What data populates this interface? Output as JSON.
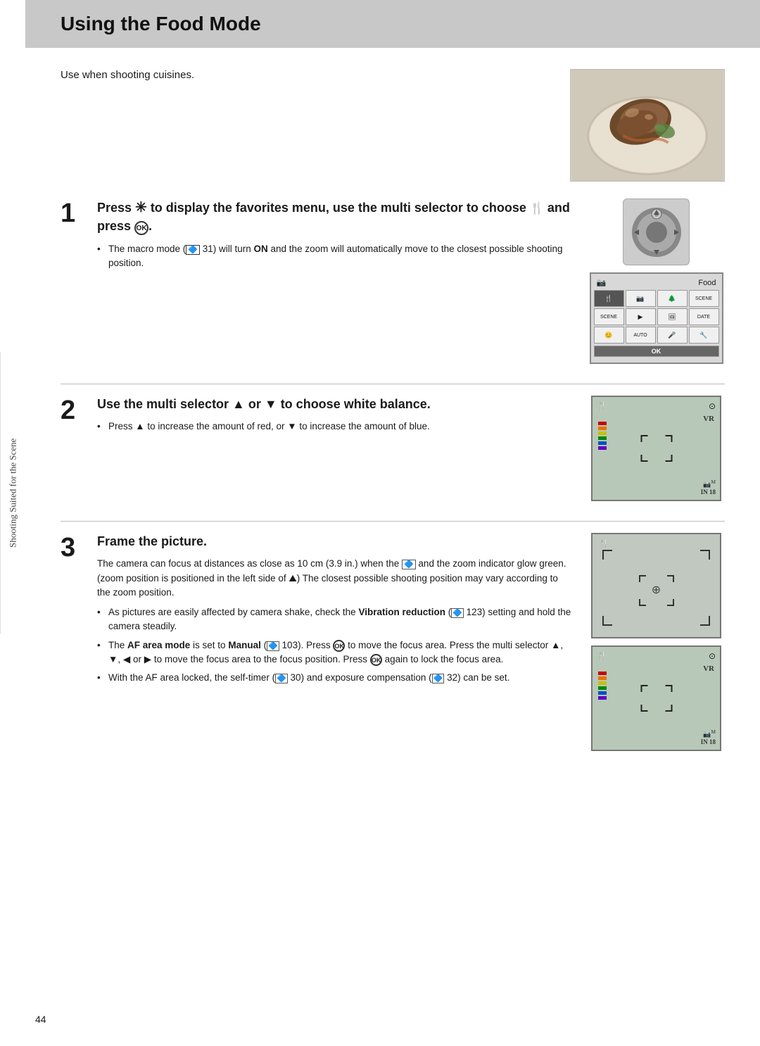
{
  "page": {
    "title": "Using the Food Mode",
    "subtitle": "Use when shooting cuisines.",
    "sidebar_label": "Shooting Suited for the Scene",
    "page_number": "44"
  },
  "step1": {
    "number": "1",
    "header": "Press ✳ to display the favorites menu, use the multi selector to choose 🍴 and press ⊛.",
    "header_plain": "Press  to display the favorites menu, use the multi selector to choose  and press .",
    "bullets": [
      "The macro mode (🔷 31) will turn ON and the zoom will automatically move to the closest possible shooting position."
    ],
    "menu_label": "Food"
  },
  "step2": {
    "number": "2",
    "header": "Use the multi selector ▲ or ▼ to choose white balance.",
    "bullets": [
      "Press ▲ to increase the amount of red, or ▼ to increase the amount of blue."
    ]
  },
  "step3": {
    "number": "3",
    "header": "Frame the picture.",
    "body": "The camera can focus at distances as close as 10 cm (3.9 in.) when the 🔷 and the zoom indicator glow green. (zoom position is positioned in the left side of 🏔) The closest possible shooting position may vary according to the zoom position.",
    "bullets": [
      "As pictures are easily affected by camera shake, check the Vibration reduction (🔷 123) setting and hold the camera steadily.",
      "The AF area mode is set to Manual (🔷 103). Press ⊛ to move the focus area. Press the multi selector ▲, ▼, ◀ or ▶ to move the focus area to the focus position. Press ⊛ again to lock the focus area.",
      "With the AF area locked, the self-timer (🔷 30) and exposure compensation (🔷 32) can be set."
    ]
  },
  "colors": {
    "title_bg": "#c8c8c8",
    "page_bg": "#ffffff",
    "lcd_bg": "#b8c8b8"
  }
}
